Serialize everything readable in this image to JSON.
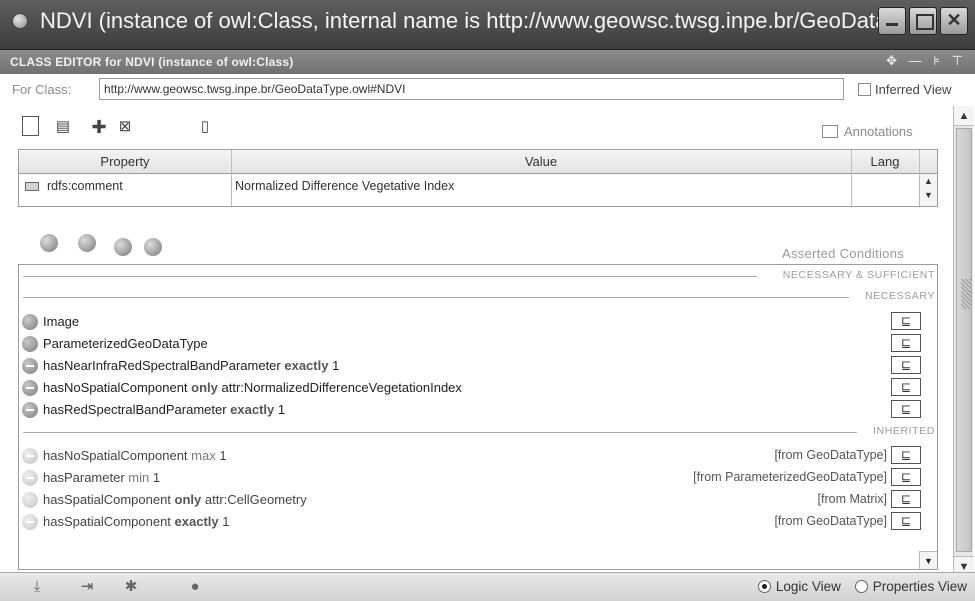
{
  "window": {
    "title": "NDVI  (instance of owl:Class, internal name is http://www.geowsc.twsg.inpe.br/GeoDataType...."
  },
  "editor": {
    "header": "CLASS EDITOR for NDVI  (instance of owl:Class)",
    "header_tools": "✥ — ⊧ ⊤",
    "for_class_label": "For Class:",
    "for_class_value": "http://www.geowsc.twsg.inpe.br/GeoDataType.owl#NDVI",
    "inferred_view": "Inferred View",
    "annotations_label": "Annotations"
  },
  "property_table": {
    "headers": [
      "Property",
      "Value",
      "Lang"
    ],
    "rows": [
      {
        "property": "rdfs:comment",
        "value": "Normalized Difference Vegetative Index",
        "lang": ""
      }
    ]
  },
  "conditions": {
    "title": "Asserted Conditions",
    "sections": {
      "necessary_sufficient": "NECESSARY & SUFFICIENT",
      "necessary": "NECESSARY",
      "inherited": "INHERITED"
    },
    "subset_symbol": "⊑",
    "necessary_rows": [
      {
        "pre": "Image",
        "kw": "",
        "post": ""
      },
      {
        "pre": "ParameterizedGeoDataType",
        "kw": "",
        "post": ""
      },
      {
        "pre": "hasNearInfraRedSpectralBandParameter ",
        "kw": "exactly",
        "post": " 1"
      },
      {
        "pre": "hasNoSpatialComponent ",
        "kw": "only",
        "post": " attr:NormalizedDifferenceVegetationIndex"
      },
      {
        "pre": "hasRedSpectralBandParameter ",
        "kw": "exactly",
        "post": " 1"
      }
    ],
    "inherited_rows": [
      {
        "pre": "hasNoSpatialComponent ",
        "kw": "max",
        "post": " 1",
        "from": "[from GeoDataType]"
      },
      {
        "pre": "hasParameter ",
        "kw": "min",
        "post": " 1",
        "from": "[from ParameterizedGeoDataType]"
      },
      {
        "pre": "hasSpatialComponent ",
        "kw": "only",
        "post": " attr:CellGeometry",
        "from": "[from Matrix]"
      },
      {
        "pre": "hasSpatialComponent ",
        "kw": "exactly",
        "post": " 1",
        "from": "[from GeoDataType]"
      }
    ]
  },
  "footer": {
    "logic_view": "Logic View",
    "properties_view": "Properties View",
    "selected_view": "Logic View"
  }
}
